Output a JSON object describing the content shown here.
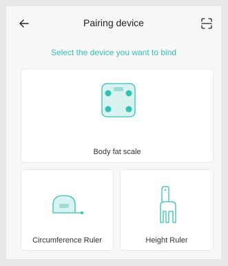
{
  "header": {
    "title": "Pairing device",
    "back_icon": "back-arrow-icon",
    "scan_icon": "scan-icon"
  },
  "subtitle": "Select the device you want to bind",
  "devices": [
    {
      "label": "Body fat scale",
      "icon": "body-fat-scale-icon"
    },
    {
      "label": "Circumference Ruler",
      "icon": "circumference-ruler-icon"
    },
    {
      "label": "Height Ruler",
      "icon": "height-ruler-icon"
    }
  ],
  "colors": {
    "accent": "#33c0b6",
    "icon_fill": "#d9f3f1",
    "background": "#f7f7f7",
    "card": "#ffffff"
  }
}
